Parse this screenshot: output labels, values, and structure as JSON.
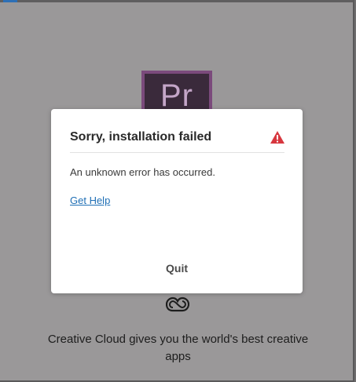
{
  "background": {
    "app_icon_letters": "Pr",
    "tagline": "Creative Cloud gives you the world's best creative apps"
  },
  "dialog": {
    "title": "Sorry, installation failed",
    "message": "An unknown error has occurred.",
    "help_link": "Get Help",
    "quit_label": "Quit"
  },
  "colors": {
    "warning": "#d7373f",
    "link": "#1f6fb5",
    "overlay": "#9a9899"
  },
  "icons": [
    "premiere-pro-app-icon",
    "warning-icon",
    "creative-cloud-icon"
  ]
}
